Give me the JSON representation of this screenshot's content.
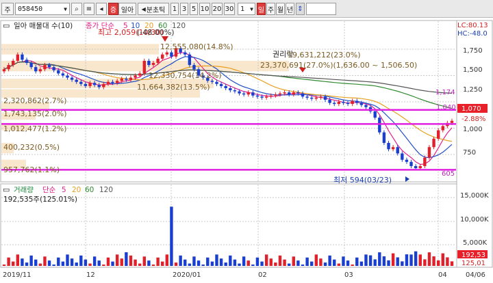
{
  "toolbar": {
    "market_label": "주",
    "stock_code": "058450",
    "mode_label": "일아",
    "mode_icon": "stock-mode-icon",
    "interval_label": "분초틱",
    "interval_buttons": [
      "1",
      "3",
      "5",
      "10",
      "20",
      "30"
    ],
    "count_value": "1",
    "period_buttons": [
      "일",
      "주",
      "월",
      "년"
    ],
    "active_period": "일"
  },
  "price_panel": {
    "title": "일아 매물대 수(10)",
    "ma_label": "종가 단순",
    "ma_periods": [
      "5",
      "10",
      "20",
      "60",
      "120"
    ],
    "ma_colors": [
      "#e0208a",
      "#2050c8",
      "#e8a020",
      "#2e8a2e",
      "#555555"
    ],
    "lc_text": "LC:80.13",
    "hc_text": "HC:-48.0",
    "y_ticks": [
      "1,750",
      "1,500",
      "1,250",
      "1,000",
      "750"
    ],
    "high_label": "최고 2,059(10/30)",
    "high_pct": "(-48.00%)",
    "low_label": "최저 594(03/23)",
    "rights_label": "권리락",
    "hline_labels": [
      "1,174",
      "1,040",
      "605"
    ],
    "current_price": "1,070",
    "current_pct": "-2.88%",
    "volume_profile": [
      "12,555,080(14.8%)",
      "23,370,691(27.0%)(1,636.00 ~ 1,506.50)",
      "12,330,754(14.2%)",
      "11,664,382(13.5%)",
      "2,320,862(2.7%)",
      "1,743,135(2.0%)",
      "1,012,477(1.2%)",
      "400,232(0.5%)",
      "957,762(1.1%)",
      "19,631,212(23.0%)"
    ]
  },
  "volume_panel": {
    "title": "거래량",
    "ma_label": "단순",
    "ma_periods": [
      "5",
      "20",
      "60",
      "120"
    ],
    "current_volume": "192,535주(125.01%)",
    "y_ticks": [
      "15,000K",
      "10,000K",
      "5,000K"
    ],
    "right_label_1": "192,53",
    "right_label_2": "125,01"
  },
  "x_axis": [
    "2019/11",
    "12",
    "2020/01",
    "02",
    "03",
    "04",
    "04/06"
  ]
}
